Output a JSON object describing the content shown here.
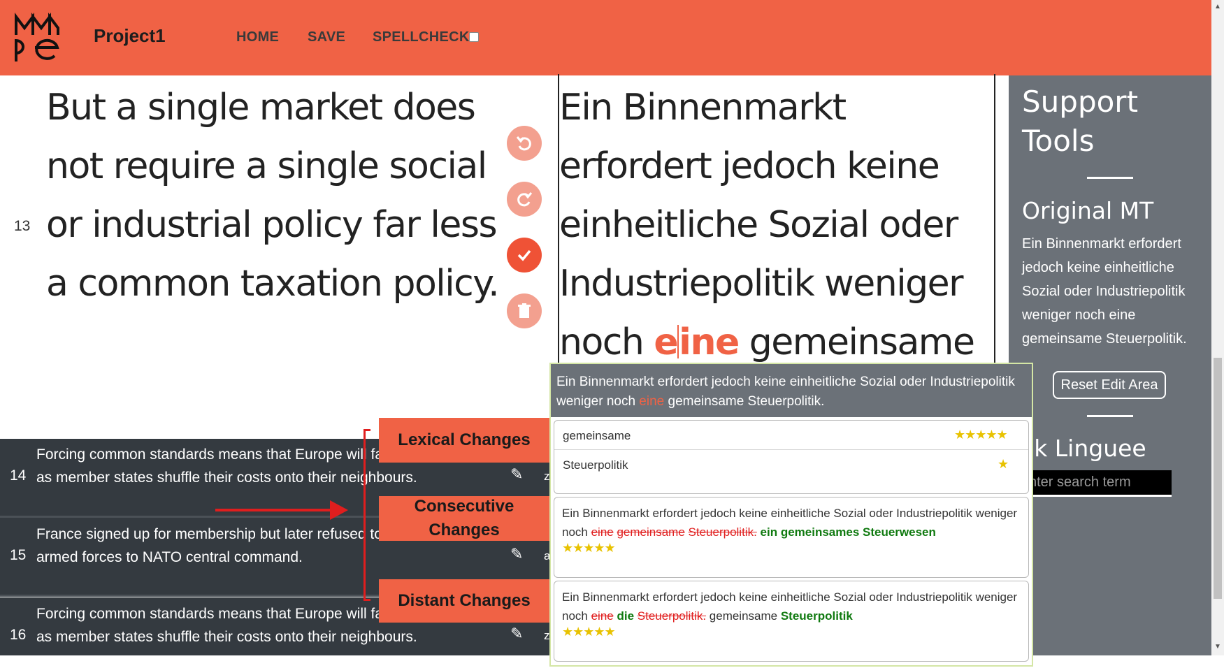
{
  "app": {
    "project_name": "Project1",
    "nav": {
      "home": "HOME",
      "save": "SAVE",
      "spellcheck": "SPELLCHECK"
    }
  },
  "editor": {
    "segment_number": "13",
    "source_text": "But a single market does not require a single social or industrial policy far less a common taxation policy.",
    "target_before": "Ein Binnenmarkt erfordert jedoch keine einheitliche Sozial oder Industriepolitik weniger noch ",
    "target_highlight_a": "e",
    "target_highlight_b": "ine",
    "target_after": " gemeinsame"
  },
  "actions": {
    "undo_icon": "undo-icon",
    "redo_icon": "redo-icon",
    "confirm_icon": "check-icon",
    "delete_icon": "trash-icon"
  },
  "sidebar": {
    "title": "Support Tools",
    "original_mt_title": "Original MT",
    "original_mt_text": "Ein Binnenmarkt erfordert jedoch keine einheitliche Sozial oder Industriepolitik weniger noch eine gemeinsame Steuerpolitik.",
    "reset_label": "Reset Edit Area",
    "linguee_title": "sk Linguee",
    "search_placeholder": "nter search term"
  },
  "segments": [
    {
      "number": "14",
      "line1": "Forcing common standards means that Europe will fa",
      "line2": "as member states shuffle their costs onto their neighbours."
    },
    {
      "number": "15",
      "line1": "France signed up for membership but later refused to",
      "line2": "armed forces to NATO central command."
    },
    {
      "number": "16",
      "line1": "Forcing common standards means that Europe will fa",
      "line2": "as member states shuffle their costs onto their neighbours."
    }
  ],
  "row_clip": [
    "z",
    "a",
    "z"
  ],
  "annotations": {
    "lexical": "Lexical Changes",
    "consecutive": "Consecutive Changes",
    "distant": "Distant Changes"
  },
  "popup": {
    "header_before": "Ein Binnenmarkt erfordert jedoch keine einheitliche Sozial oder Industriepolitik weniger noch ",
    "header_highlight": "eine",
    "header_after": " gemeinsame Steuerpolitik.",
    "word_suggestions": [
      {
        "word": "gemeinsame",
        "stars": "★★★★★"
      },
      {
        "word": "Steuerpolitik",
        "stars": "★"
      }
    ],
    "consecutive": {
      "prefix": "Ein Binnenmarkt erfordert jedoch keine einheitliche Sozial oder Industriepolitik weniger noch ",
      "del1": "eine",
      "del2": "gemeinsame",
      "del3": "Steuerpolitik.",
      "add": "ein gemeinsames Steuerwesen",
      "stars": "★★★★★"
    },
    "distant": {
      "prefix": "Ein Binnenmarkt erfordert jedoch keine einheitliche Sozial oder Industriepolitik weniger noch ",
      "del1": "eine",
      "add1": "die",
      "del2": "Steuerpolitik.",
      "mid": "gemeinsame",
      "add2": "Steuerpolitik",
      "stars": "★★★★★"
    }
  },
  "colors": {
    "brand": "#f06245",
    "sidebar": "#6b7178",
    "segment_row": "#343a40",
    "deletion": "#e01e1e",
    "insertion": "#107a10",
    "star": "#e8c200"
  }
}
